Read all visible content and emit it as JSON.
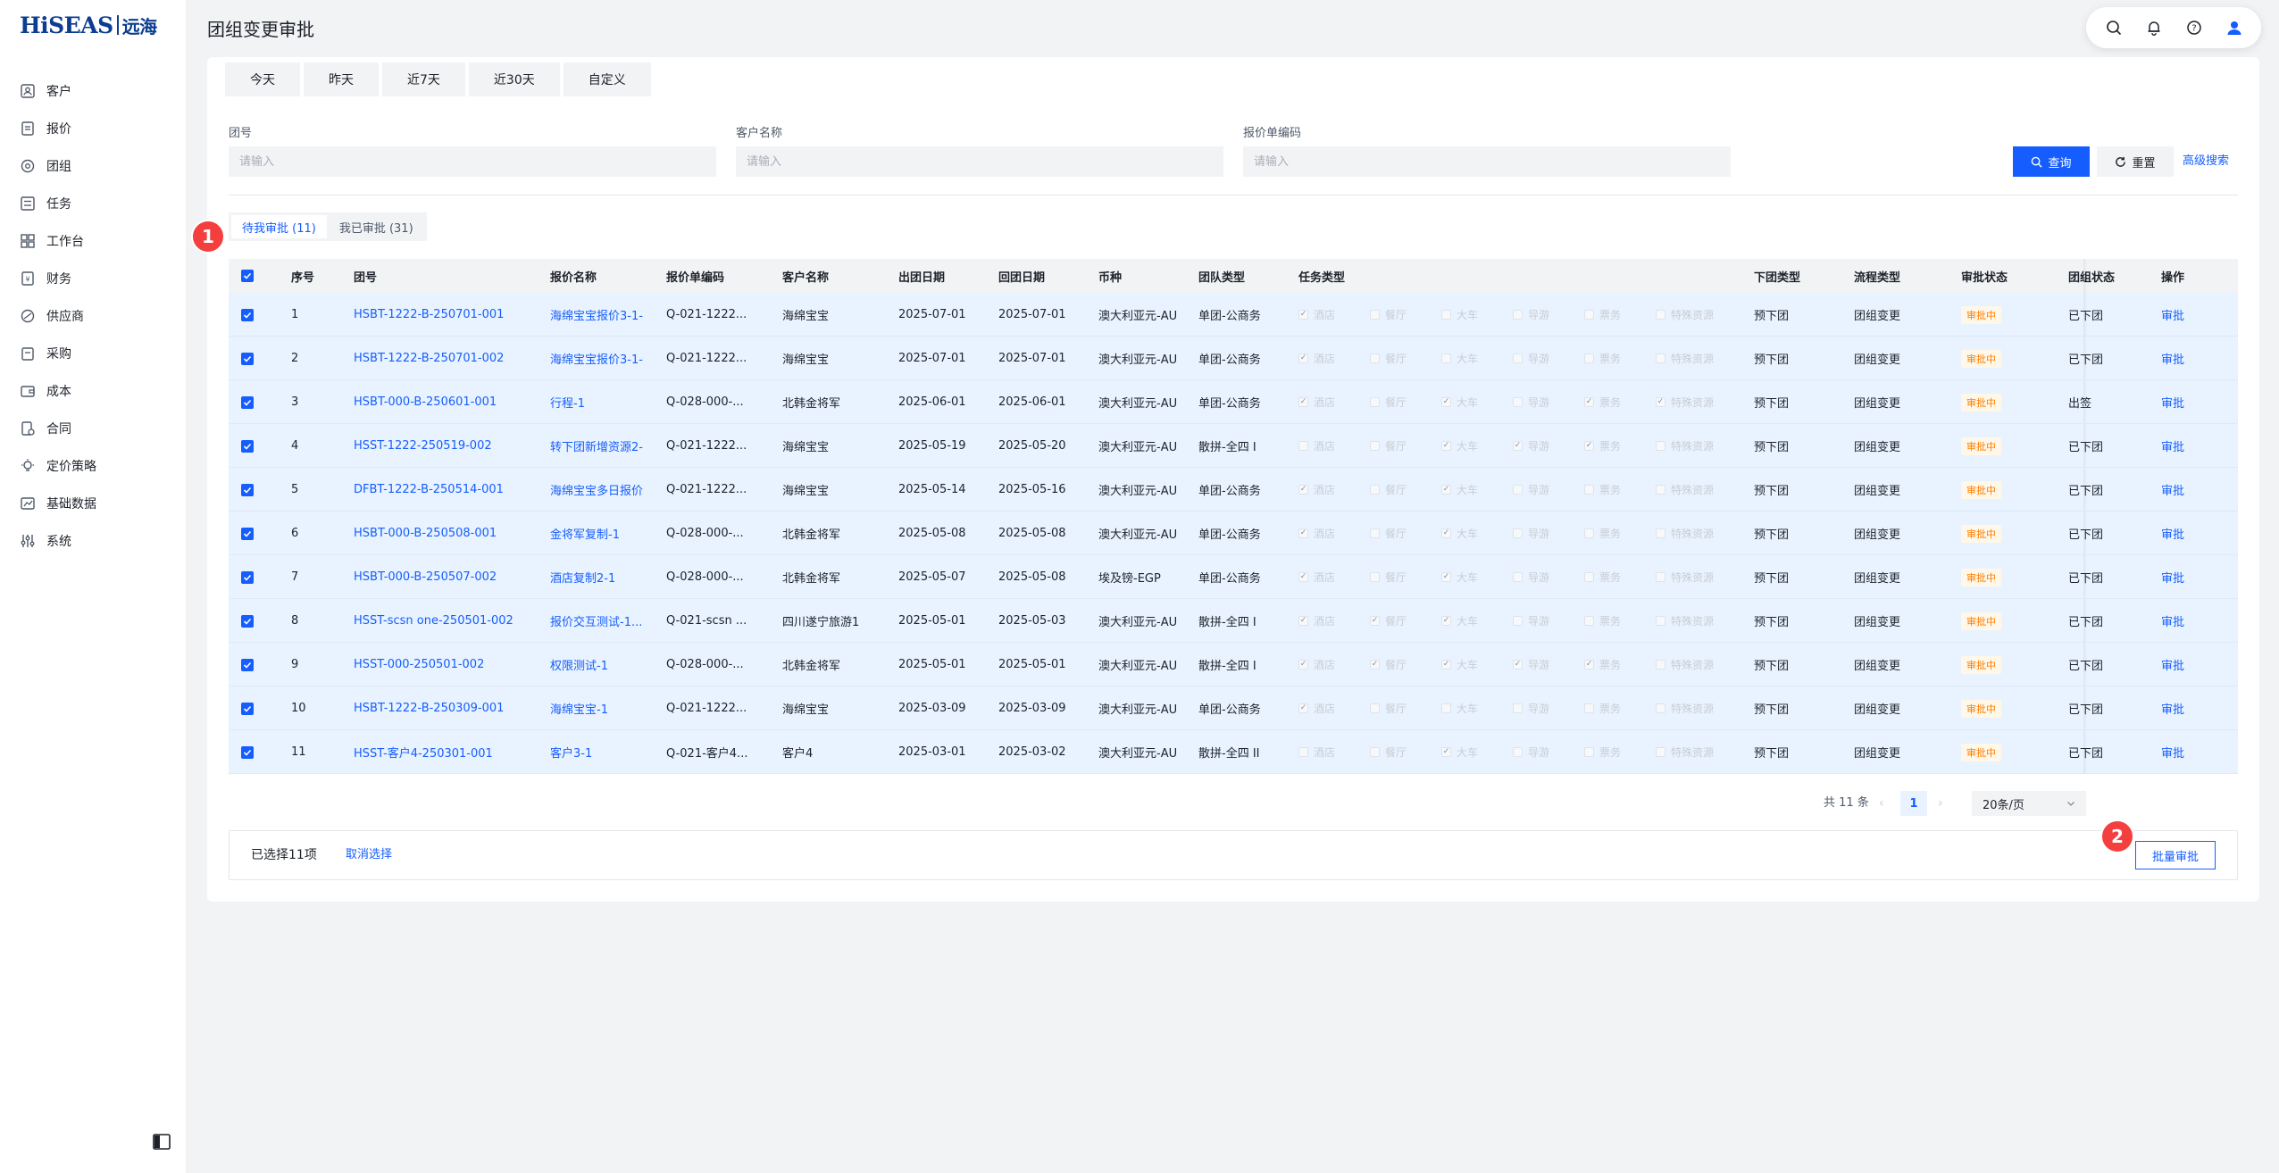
{
  "brand": {
    "logo_latin": "HiSEAS",
    "logo_cn": "远海"
  },
  "page": {
    "title": "团组变更审批"
  },
  "sidebar": {
    "items": [
      {
        "label": "客户",
        "icon": "customer-icon"
      },
      {
        "label": "报价",
        "icon": "quote-icon"
      },
      {
        "label": "团组",
        "icon": "group-icon"
      },
      {
        "label": "任务",
        "icon": "task-icon"
      },
      {
        "label": "工作台",
        "icon": "workbench-icon"
      },
      {
        "label": "财务",
        "icon": "finance-icon"
      },
      {
        "label": "供应商",
        "icon": "supplier-icon"
      },
      {
        "label": "采购",
        "icon": "purchase-icon"
      },
      {
        "label": "成本",
        "icon": "cost-icon"
      },
      {
        "label": "合同",
        "icon": "contract-icon"
      },
      {
        "label": "定价策略",
        "icon": "pricing-icon"
      },
      {
        "label": "基础数据",
        "icon": "basedata-icon"
      },
      {
        "label": "系统",
        "icon": "system-icon"
      }
    ]
  },
  "date_tabs": [
    "今天",
    "昨天",
    "近7天",
    "近30天",
    "自定义"
  ],
  "filters": {
    "group_no": {
      "label": "团号",
      "placeholder": "请输入"
    },
    "customer": {
      "label": "客户名称",
      "placeholder": "请输入"
    },
    "quote_code": {
      "label": "报价单编码",
      "placeholder": "请输入"
    },
    "query_label": "查询",
    "reset_label": "重置",
    "advanced_label": "高级搜索"
  },
  "approval_tabs": {
    "pending": "待我审批 (11)",
    "done": "我已审批 (31)"
  },
  "markers": {
    "one": "1",
    "two": "2"
  },
  "table": {
    "headers": {
      "seq": "序号",
      "group_no": "团号",
      "quote_name": "报价名称",
      "quote_code": "报价单编码",
      "customer": "客户名称",
      "depart": "出团日期",
      "return": "回团日期",
      "currency": "币种",
      "team_type": "团队类型",
      "task_type": "任务类型",
      "order_type": "下团类型",
      "flow_type": "流程类型",
      "approval_status": "审批状态",
      "group_status": "团组状态",
      "action": "操作"
    },
    "task_labels": [
      "酒店",
      "餐厅",
      "大车",
      "导游",
      "票务",
      "特殊资源"
    ],
    "rows": [
      {
        "seq": "1",
        "group_no": "HSBT-1222-B-250701-001",
        "quote_name": "海绵宝宝报价3-1-",
        "quote_code": "Q-021-1222...",
        "customer": "海绵宝宝",
        "depart": "2025-07-01",
        "return": "2025-07-01",
        "currency": "澳大利亚元-AU",
        "team_type": "单团-公商务",
        "tasks": [
          1,
          0,
          0,
          0,
          0,
          0
        ],
        "order_type": "预下团",
        "flow_type": "团组变更",
        "approval_status": "审批中",
        "group_status": "已下团",
        "action": "审批"
      },
      {
        "seq": "2",
        "group_no": "HSBT-1222-B-250701-002",
        "quote_name": "海绵宝宝报价3-1-",
        "quote_code": "Q-021-1222...",
        "customer": "海绵宝宝",
        "depart": "2025-07-01",
        "return": "2025-07-01",
        "currency": "澳大利亚元-AU",
        "team_type": "单团-公商务",
        "tasks": [
          1,
          0,
          0,
          0,
          0,
          0
        ],
        "order_type": "预下团",
        "flow_type": "团组变更",
        "approval_status": "审批中",
        "group_status": "已下团",
        "action": "审批"
      },
      {
        "seq": "3",
        "group_no": "HSBT-000-B-250601-001",
        "quote_name": "行程-1",
        "quote_code": "Q-028-000-...",
        "customer": "北韩金将军",
        "depart": "2025-06-01",
        "return": "2025-06-01",
        "currency": "澳大利亚元-AU",
        "team_type": "单团-公商务",
        "tasks": [
          1,
          0,
          1,
          0,
          1,
          1
        ],
        "order_type": "预下团",
        "flow_type": "团组变更",
        "approval_status": "审批中",
        "group_status": "出签",
        "action": "审批"
      },
      {
        "seq": "4",
        "group_no": "HSST-1222-250519-002",
        "quote_name": "转下团新增资源2-",
        "quote_code": "Q-021-1222...",
        "customer": "海绵宝宝",
        "depart": "2025-05-19",
        "return": "2025-05-20",
        "currency": "澳大利亚元-AU",
        "team_type": "散拼-全四 I",
        "tasks": [
          0,
          0,
          1,
          1,
          1,
          0
        ],
        "order_type": "预下团",
        "flow_type": "团组变更",
        "approval_status": "审批中",
        "group_status": "已下团",
        "action": "审批"
      },
      {
        "seq": "5",
        "group_no": "DFBT-1222-B-250514-001",
        "quote_name": "海绵宝宝多日报价",
        "quote_code": "Q-021-1222...",
        "customer": "海绵宝宝",
        "depart": "2025-05-14",
        "return": "2025-05-16",
        "currency": "澳大利亚元-AU",
        "team_type": "单团-公商务",
        "tasks": [
          1,
          0,
          1,
          0,
          0,
          0
        ],
        "order_type": "预下团",
        "flow_type": "团组变更",
        "approval_status": "审批中",
        "group_status": "已下团",
        "action": "审批"
      },
      {
        "seq": "6",
        "group_no": "HSBT-000-B-250508-001",
        "quote_name": "金将军复制-1",
        "quote_code": "Q-028-000-...",
        "customer": "北韩金将军",
        "depart": "2025-05-08",
        "return": "2025-05-08",
        "currency": "澳大利亚元-AU",
        "team_type": "单团-公商务",
        "tasks": [
          1,
          0,
          1,
          0,
          0,
          0
        ],
        "order_type": "预下团",
        "flow_type": "团组变更",
        "approval_status": "审批中",
        "group_status": "已下团",
        "action": "审批"
      },
      {
        "seq": "7",
        "group_no": "HSBT-000-B-250507-002",
        "quote_name": "酒店复制2-1",
        "quote_code": "Q-028-000-...",
        "customer": "北韩金将军",
        "depart": "2025-05-07",
        "return": "2025-05-08",
        "currency": "埃及镑-EGP",
        "team_type": "单团-公商务",
        "tasks": [
          1,
          0,
          1,
          0,
          0,
          0
        ],
        "order_type": "预下团",
        "flow_type": "团组变更",
        "approval_status": "审批中",
        "group_status": "已下团",
        "action": "审批"
      },
      {
        "seq": "8",
        "group_no": "HSST-scsn one-250501-002",
        "quote_name": "报价交互测试-1...",
        "quote_code": "Q-021-scsn ...",
        "customer": "四川遂宁旅游1",
        "depart": "2025-05-01",
        "return": "2025-05-03",
        "currency": "澳大利亚元-AU",
        "team_type": "散拼-全四 I",
        "tasks": [
          1,
          1,
          1,
          0,
          0,
          0
        ],
        "order_type": "预下团",
        "flow_type": "团组变更",
        "approval_status": "审批中",
        "group_status": "已下团",
        "action": "审批"
      },
      {
        "seq": "9",
        "group_no": "HSST-000-250501-002",
        "quote_name": "权限测试-1",
        "quote_code": "Q-028-000-...",
        "customer": "北韩金将军",
        "depart": "2025-05-01",
        "return": "2025-05-01",
        "currency": "澳大利亚元-AU",
        "team_type": "散拼-全四 I",
        "tasks": [
          1,
          1,
          1,
          1,
          1,
          0
        ],
        "order_type": "预下团",
        "flow_type": "团组变更",
        "approval_status": "审批中",
        "group_status": "已下团",
        "action": "审批"
      },
      {
        "seq": "10",
        "group_no": "HSBT-1222-B-250309-001",
        "quote_name": "海绵宝宝-1",
        "quote_code": "Q-021-1222...",
        "customer": "海绵宝宝",
        "depart": "2025-03-09",
        "return": "2025-03-09",
        "currency": "澳大利亚元-AU",
        "team_type": "单团-公商务",
        "tasks": [
          1,
          0,
          0,
          0,
          0,
          0
        ],
        "order_type": "预下团",
        "flow_type": "团组变更",
        "approval_status": "审批中",
        "group_status": "已下团",
        "action": "审批"
      },
      {
        "seq": "11",
        "group_no": "HSST-客户4-250301-001",
        "quote_name": "客户3-1",
        "quote_code": "Q-021-客户4...",
        "customer": "客户4",
        "depart": "2025-03-01",
        "return": "2025-03-02",
        "currency": "澳大利亚元-AU",
        "team_type": "散拼-全四 II",
        "tasks": [
          0,
          0,
          1,
          0,
          0,
          0
        ],
        "order_type": "预下团",
        "flow_type": "团组变更",
        "approval_status": "审批中",
        "group_status": "已下团",
        "action": "审批"
      }
    ]
  },
  "pagination": {
    "total": "共 11 条",
    "current": "1",
    "page_size": "20条/页"
  },
  "footer": {
    "selected": "已选择11项",
    "cancel": "取消选择",
    "batch": "批量审批"
  },
  "colors": {
    "primary": "#165dff",
    "row_selected": "#e8f3ff",
    "warning": "#ff7d00",
    "marker": "#f53f3f"
  }
}
